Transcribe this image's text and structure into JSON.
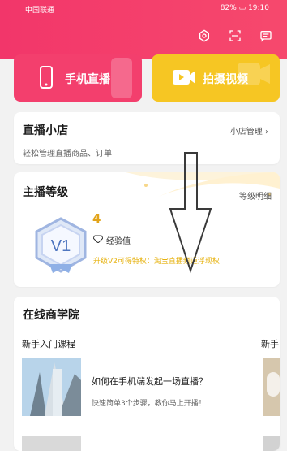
{
  "status": {
    "carrier": "中国联通",
    "battery": "82%",
    "time": "19:10"
  },
  "topbar": {
    "icons": [
      "settings-icon",
      "scan-icon",
      "message-icon"
    ]
  },
  "actions": [
    {
      "label": "手机直播",
      "icon": "phone-icon",
      "color": "#f33f6d"
    },
    {
      "label": "拍摄视频",
      "icon": "video-camera-icon",
      "color": "#f6c623"
    }
  ],
  "shop": {
    "title": "直播小店",
    "manage": "小店管理",
    "subtitle": "轻松管理直播商品、订单"
  },
  "level": {
    "title": "主播等级",
    "detail_link": "等级明细",
    "badge": "V1",
    "level_number": "4",
    "exp_label": "经验值",
    "promo_text": "升级V2可得特权：淘宝直播频道浮现权"
  },
  "academy": {
    "title": "在线商学院",
    "sections": [
      "新手入门课程",
      "新手"
    ],
    "courses": [
      {
        "title": "如何在手机端发起一场直播？",
        "desc": "快速简单3个步骤，教你马上开播！"
      }
    ]
  },
  "colors": {
    "accent": "#f2366a",
    "gold": "#e2a41a",
    "yellow": "#f6c623"
  }
}
